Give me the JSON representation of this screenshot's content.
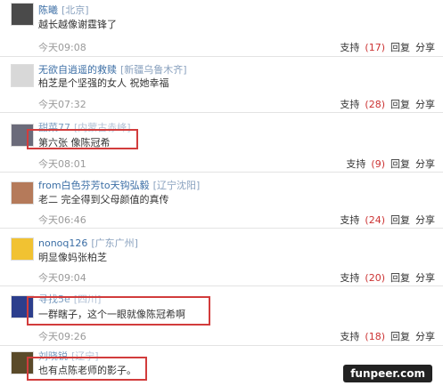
{
  "comments": [
    {
      "user": "陈曦",
      "loc": "[北京]",
      "msg": "越长越像谢霆锋了",
      "time": "今天09:08",
      "support": "支持",
      "count": "(17)",
      "reply": "回复",
      "share": "分享",
      "avatar": "#4a4a4a"
    },
    {
      "user": "无欲自逍遥的救赎",
      "loc": "[新疆乌鲁木齐]",
      "msg": "柏芝是个坚强的女人 祝她幸福",
      "time": "今天07:32",
      "support": "支持",
      "count": "(28)",
      "reply": "回复",
      "share": "分享",
      "avatar": "#d8d8d8"
    },
    {
      "user": "甜菜77",
      "loc": "[内蒙古赤峰]",
      "msg": "第六张 像陈冠希",
      "time": "今天08:01",
      "support": "支持",
      "count": "(9)",
      "reply": "回复",
      "share": "分享",
      "avatar": "#6b6b7a"
    },
    {
      "user": "from白色芬芳to天钩弘毅",
      "loc": "[辽宁沈阳]",
      "msg": "老二 完全得到父母颜值的真传",
      "time": "今天06:46",
      "support": "支持",
      "count": "(24)",
      "reply": "回复",
      "share": "分享",
      "avatar": "#b57a5a"
    },
    {
      "user": "nonoq126",
      "loc": "[广东广州]",
      "msg": "明显像妈张柏芝",
      "time": "今天09:04",
      "support": "支持",
      "count": "(20)",
      "reply": "回复",
      "share": "分享",
      "avatar": "#f1c232"
    },
    {
      "user": "寻找5e",
      "loc": "[四川]",
      "msg": "一群瞎子，这个一眼就像陈冠希啊",
      "time": "今天09:26",
      "support": "支持",
      "count": "(18)",
      "reply": "回复",
      "share": "分享",
      "avatar": "#2c3e8c"
    },
    {
      "user": "刘晓锐",
      "loc": "[辽宁]",
      "msg": "也有点陈老师的影子。",
      "time": "",
      "support": "",
      "count": "",
      "reply": "",
      "share": "",
      "avatar": "#5a4a2a"
    }
  ],
  "watermark": "funpeer.com"
}
